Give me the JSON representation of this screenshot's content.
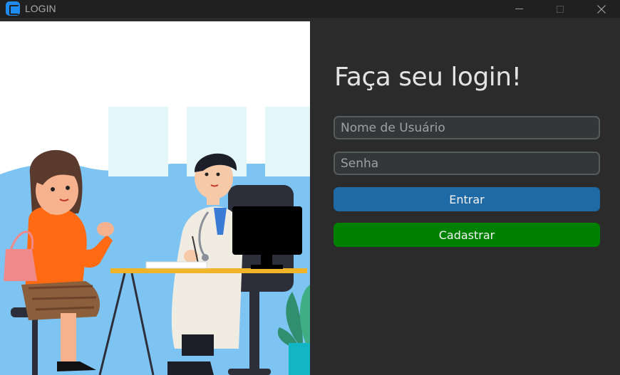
{
  "window": {
    "title": "LOGIN",
    "icon": "app-logo-icon",
    "controls": [
      "minimize-icon",
      "maximize-icon",
      "close-icon"
    ]
  },
  "illustration": {
    "subject": "patient-and-doctor-consultation",
    "colors": {
      "blob": "#7dc4f2",
      "window_panes": "#e3f7fa",
      "patient_sweater": "#ff6a13",
      "doctor_coat": "#f1ece2",
      "desk": "#f0b429",
      "monitor": "#000000",
      "chair": "#2c2f3a",
      "plant": "#2f8f6f",
      "pot": "#12b5c4"
    }
  },
  "login": {
    "title": "Faça seu login!",
    "username_placeholder": "Nome de Usuário",
    "username_value": "",
    "password_placeholder": "Senha",
    "password_value": "",
    "login_button": "Entrar",
    "register_button": "Cadastrar"
  },
  "theme": {
    "background": "#2b2b2b",
    "titlebar": "#202020",
    "field_bg": "#343638",
    "field_border": "#565b5e",
    "primary_button": "#1f6aa5",
    "register_button": "#008000",
    "text": "#e3e3e3"
  }
}
